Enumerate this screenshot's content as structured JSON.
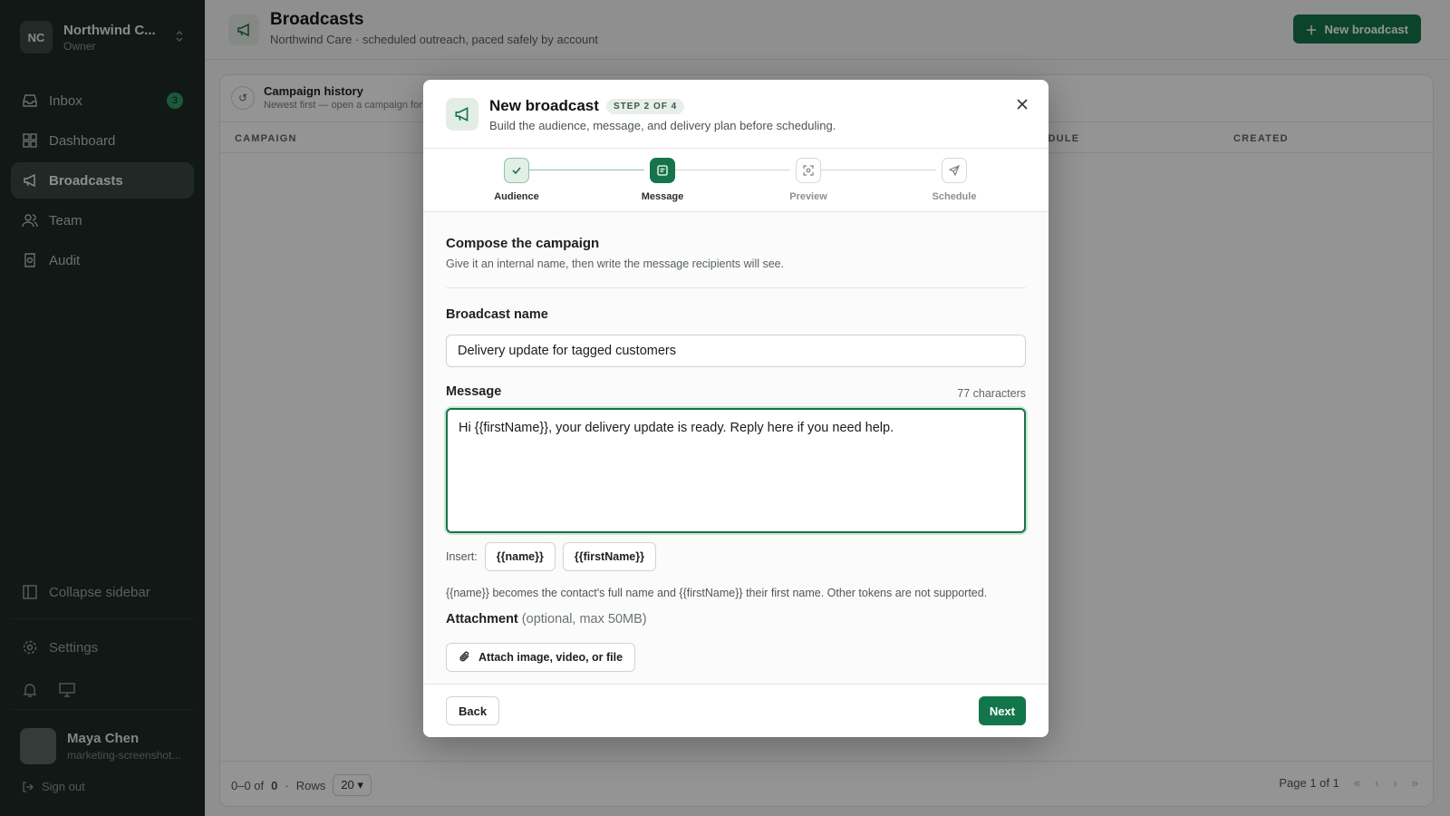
{
  "sidebar": {
    "org": {
      "initials": "NC",
      "name": "Northwind C...",
      "role": "Owner"
    },
    "nav": [
      {
        "label": "Inbox",
        "icon": "inbox-icon",
        "badge": "3"
      },
      {
        "label": "Dashboard",
        "icon": "dashboard-icon"
      },
      {
        "label": "Broadcasts",
        "icon": "megaphone-icon",
        "active": true
      },
      {
        "label": "Team",
        "icon": "team-icon"
      },
      {
        "label": "Audit",
        "icon": "audit-icon"
      }
    ],
    "collapse_label": "Collapse sidebar",
    "settings_label": "Settings",
    "user": {
      "name": "Maya Chen",
      "email": "marketing-screenshot..."
    },
    "signout_label": "Sign out"
  },
  "header": {
    "title": "Broadcasts",
    "subtitle": "Northwind Care · scheduled outreach, paced safely by account",
    "new_button": "New broadcast"
  },
  "panel": {
    "title": "Campaign history",
    "subtitle": "Newest first — open a campaign for",
    "columns": [
      "CAMPAIGN",
      "EDULE",
      "CREATED"
    ],
    "footer": {
      "range": "0–0 of",
      "total": "0",
      "rows_label": "Rows",
      "rows_value": "20",
      "page": "Page 1 of 1"
    }
  },
  "modal": {
    "title": "New broadcast",
    "step_pill": "STEP 2 OF 4",
    "subtitle": "Build the audience, message, and delivery plan before scheduling.",
    "steps": [
      {
        "label": "Audience",
        "state": "done"
      },
      {
        "label": "Message",
        "state": "active"
      },
      {
        "label": "Preview",
        "state": "todo"
      },
      {
        "label": "Schedule",
        "state": "todo"
      }
    ],
    "section_title": "Compose the campaign",
    "section_subtitle": "Give it an internal name, then write the message recipients will see.",
    "name_label": "Broadcast name",
    "name_value": "Delivery update for tagged customers",
    "message_label": "Message",
    "char_count": "77 characters",
    "message_value": "Hi {{firstName}}, your delivery update is ready. Reply here if you need help.",
    "insert_label": "Insert:",
    "tokens": [
      "{{name}}",
      "{{firstName}}"
    ],
    "hint": "{{name}} becomes the contact's full name and {{firstName}} their first name. Other tokens are not supported.",
    "attachment_label": "Attachment",
    "attachment_optional": "(optional, max 50MB)",
    "attach_button": "Attach image, video, or file",
    "back_button": "Back",
    "next_button": "Next"
  },
  "colors": {
    "accent": "#13764a",
    "sidebar": "#1f2a26"
  }
}
